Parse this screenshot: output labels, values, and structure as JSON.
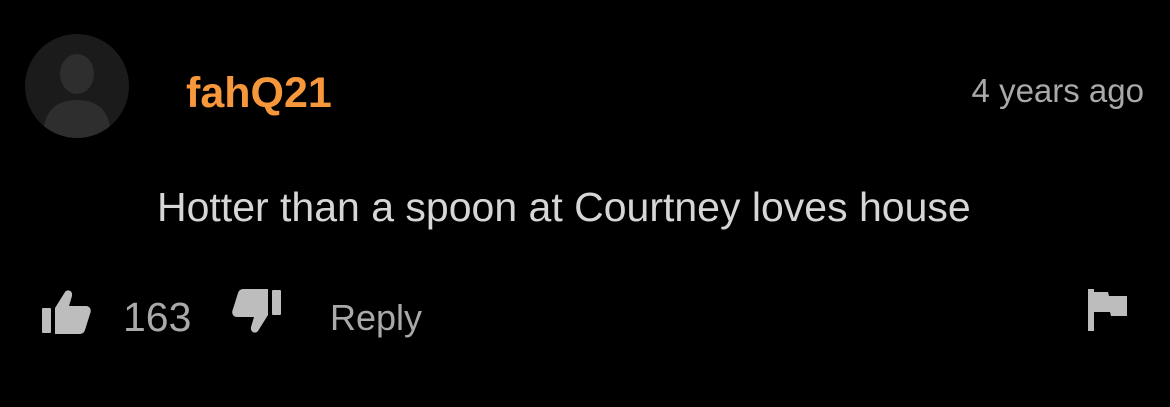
{
  "comment": {
    "username": "fahQ21",
    "timestamp": "4 years ago",
    "text": "Hotter than a spoon at Courtney loves house",
    "likes": "163",
    "reply_label": "Reply"
  },
  "icons": {
    "avatar": "default-user-silhouette-icon",
    "like": "thumbs-up-icon",
    "dislike": "thumbs-down-icon",
    "flag": "flag-icon"
  },
  "colors": {
    "background": "#000000",
    "username": "#f5973a",
    "meta_text": "#a9a9a9",
    "body_text": "#d6d6d6",
    "avatar_bg": "#1b1b1b",
    "avatar_figure": "#2e2e2e",
    "icon": "#bdbdbd"
  }
}
